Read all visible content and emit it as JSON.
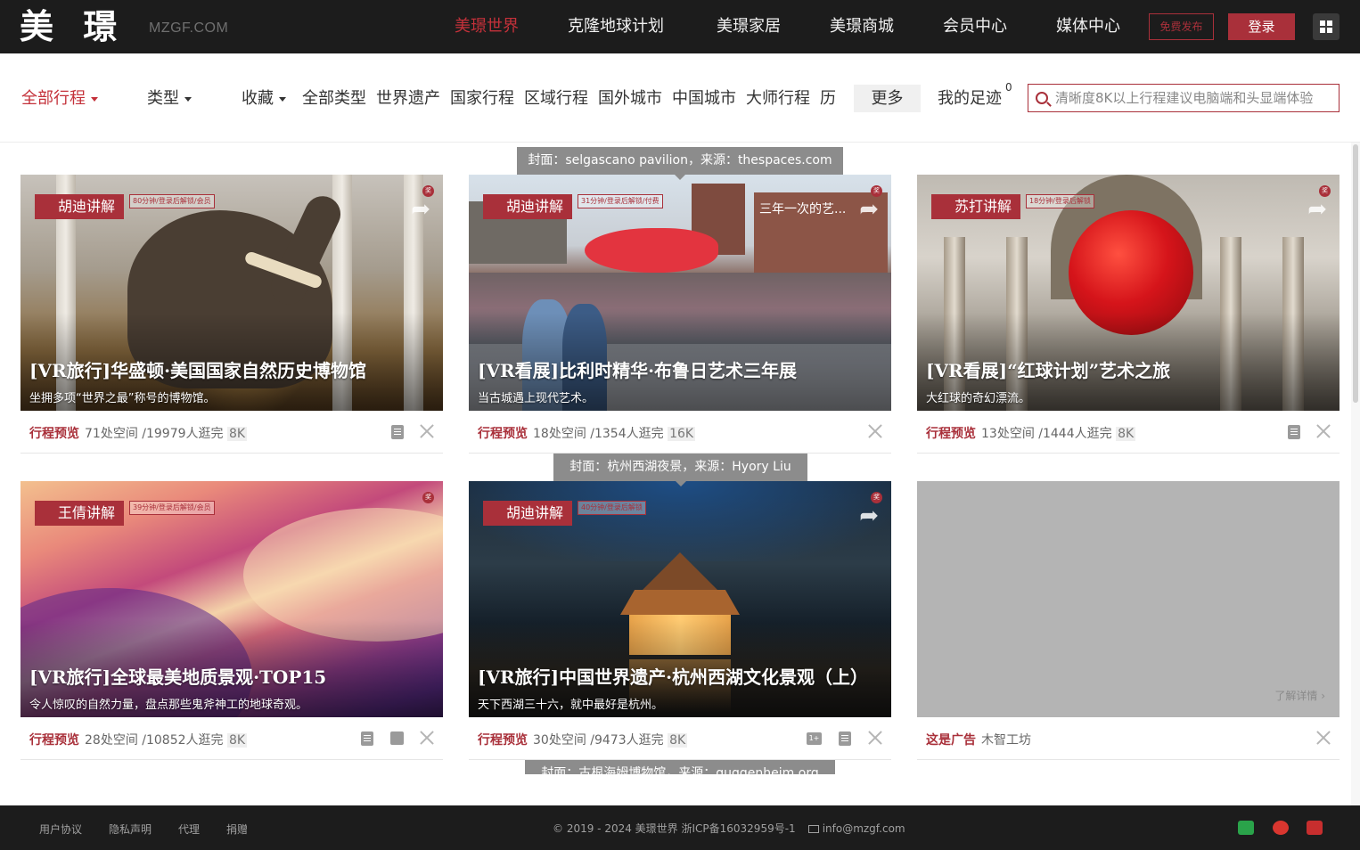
{
  "header": {
    "logo": "美 璟",
    "logo_sub": "MZGF.COM",
    "nav": [
      "美璟世界",
      "克隆地球计划",
      "美璟家居",
      "美璟商城",
      "会员中心",
      "媒体中心"
    ],
    "publish": "免费发布",
    "login": "登录"
  },
  "filters": {
    "all_trips": "全部行程",
    "type": "类型",
    "favorites": "收藏",
    "categories": [
      "全部类型",
      "世界遗产",
      "国家行程",
      "区域行程",
      "国外城市",
      "中国城市",
      "大师行程",
      "历史"
    ],
    "more": "更多",
    "footprint": "我的足迹",
    "footprint_count": "0",
    "search_placeholder": "清晰度8K以上行程建议电脑端和头显端体验"
  },
  "tooltips": [
    "封面：selgascano pavilion，来源：thespaces.com",
    "封面：杭州西湖夜景，来源：Hyory Liu",
    "封面：古根海姆博物馆，来源：guggenheim.org"
  ],
  "cards": [
    {
      "guide": "胡迪讲解",
      "note": "80分钟/登录后解锁/会员",
      "title": "[VR旅行]华盛顿·美国国家自然历史博物馆",
      "subtitle": "坐拥多项“世界之最”称号的博物馆。",
      "preview": "行程预览",
      "stats": "71处空间 /19979人逛完",
      "quality": "8K"
    },
    {
      "guide": "胡迪讲解",
      "note": "31分钟/登录后解锁/付费",
      "corner": "三年一次的艺...",
      "title": "[VR看展]比利时精华·布鲁日艺术三年展",
      "subtitle": "当古城遇上现代艺术。",
      "preview": "行程预览",
      "stats": "18处空间 /1354人逛完",
      "quality": "16K"
    },
    {
      "guide": "苏打讲解",
      "note": "18分钟/登录后解锁",
      "title": "[VR看展]“红球计划”艺术之旅",
      "subtitle": "大红球的奇幻漂流。",
      "preview": "行程预览",
      "stats": "13处空间 /1444人逛完",
      "quality": "8K"
    },
    {
      "guide": "王倩讲解",
      "note": "39分钟/登录后解锁/会员",
      "title": "[VR旅行]全球最美地质景观·TOP15",
      "subtitle": "令人惊叹的自然力量，盘点那些鬼斧神工的地球奇观。",
      "preview": "行程预览",
      "stats": "28处空间 /10852人逛完",
      "quality": "8K"
    },
    {
      "guide": "胡迪讲解",
      "note": "40分钟/登录后解锁",
      "title": "[VR旅行]中国世界遗产·杭州西湖文化景观（上）",
      "subtitle": "天下西湖三十六，就中最好是杭州。",
      "preview": "行程预览",
      "stats": "30处空间 /9473人逛完",
      "quality": "8K"
    }
  ],
  "ad": {
    "more": "了解详情 ›",
    "label": "这是广告",
    "name": "木智工坊"
  },
  "badge_text": "奖",
  "footer": {
    "links": [
      "用户协议",
      "隐私声明",
      "代理",
      "捐赠"
    ],
    "copyright": "© 2019 - 2024 美璟世界 浙ICP备16032959号-1",
    "email": "info@mzgf.com"
  },
  "colors": {
    "brand": "#a9303a",
    "header_bg": "#1c1c1c"
  }
}
